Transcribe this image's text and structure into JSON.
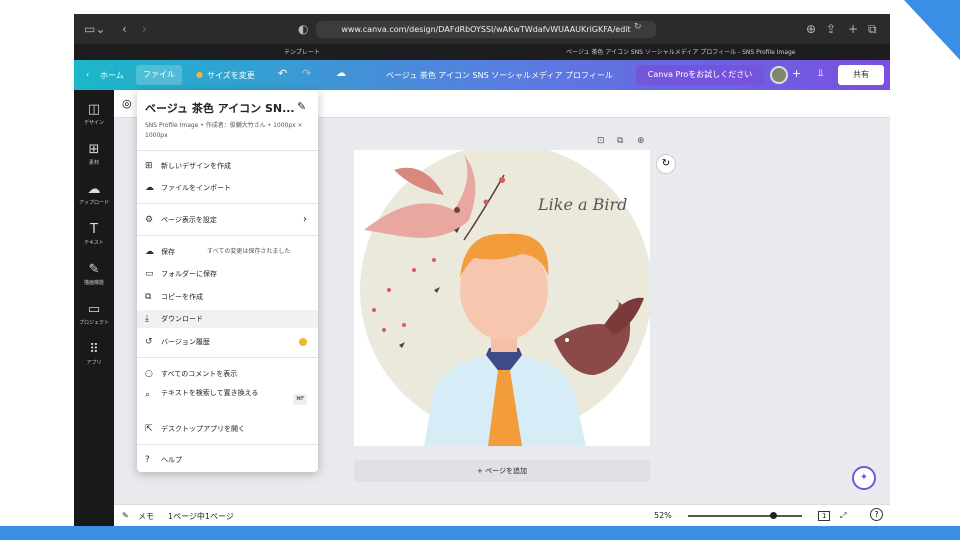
{
  "browser": {
    "url": "www.canva.com/design/DAFdRbOYSSI/wAKwTWdafvWUAAUKriGKFA/edit",
    "tab1": "テンプレート",
    "tab2": "ベージュ 茶色 アイコン SNS ソーシャルメディア プロフィール - SNS Profile Image"
  },
  "topbar": {
    "home": "ホーム",
    "file": "ファイル",
    "resize": "サイズを変更",
    "design_title": "ベージュ 茶色 アイコン SNS ソーシャルメディア プロフィール",
    "pro": "Canva Proをお試しください",
    "share": "共有",
    "accent_start": "#1bb8c8",
    "accent_end": "#7b4fe0"
  },
  "leftnav": [
    "デザイン",
    "素材",
    "アップロード",
    "テキスト",
    "描画機能",
    "プロジェクト",
    "アプリ"
  ],
  "menu": {
    "title": "ベージュ 茶色 アイコン SN...",
    "subtitle": "SNS Profile Image • 作成者：俊輔大竹さん • 1000px × 1000px",
    "items": {
      "new_design": "新しいデザインを作成",
      "import": "ファイルをインポート",
      "page_settings": "ページ表示を設定",
      "save": "保存",
      "saved_status": "すべての変更は保存されました",
      "save_folder": "フォルダーに保存",
      "copy": "コピーを作成",
      "download": "ダウンロード",
      "version": "バージョン履歴",
      "comments": "すべてのコメントを表示",
      "find_replace": "テキストを検索して置き換える",
      "find_shortcut": "⌘F",
      "desktop": "デスクトップアプリを開く",
      "help": "ヘルプ"
    }
  },
  "canvas": {
    "script_text": "Like a Bird",
    "add_page": "+ ページを追加"
  },
  "bottombar": {
    "memo": "メモ",
    "page_count": "1ページ中1ページ",
    "zoom": "52%",
    "page_num": "1"
  }
}
